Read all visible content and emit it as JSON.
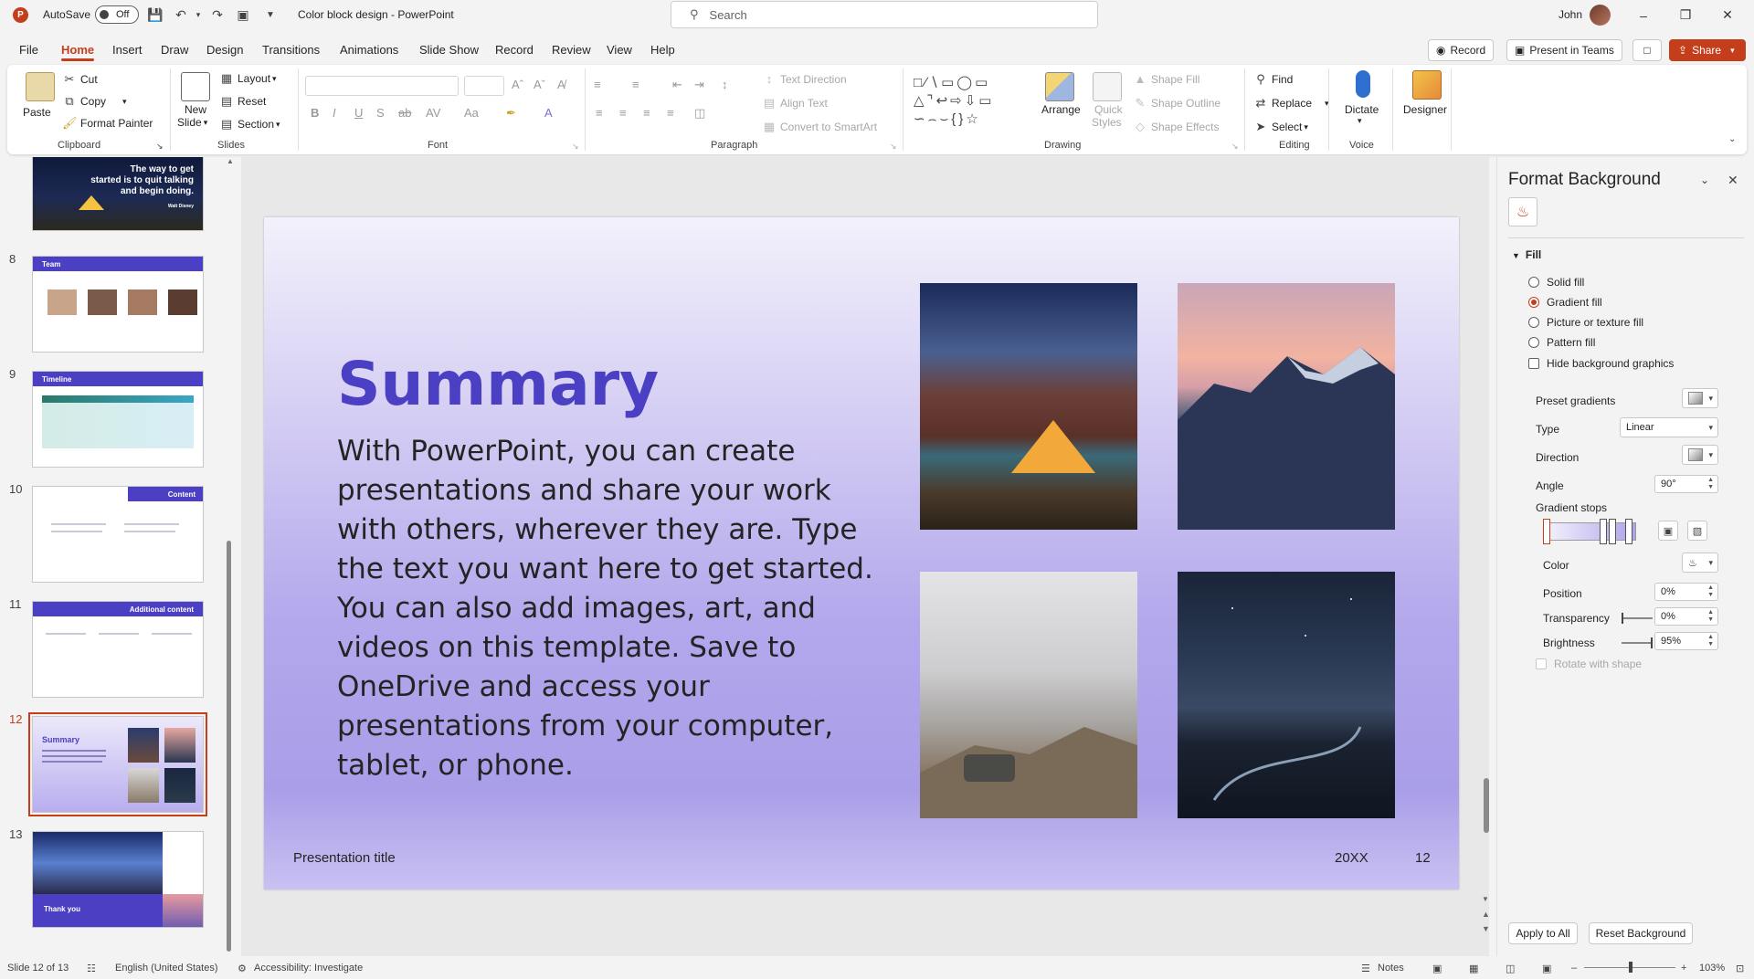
{
  "titlebar": {
    "app_letter": "P",
    "autosave_label": "AutoSave",
    "autosave_state": "Off",
    "doc_title": "Color block design  -  PowerPoint",
    "search_placeholder": "Search",
    "user_name": "John"
  },
  "tabs": [
    "File",
    "Home",
    "Insert",
    "Draw",
    "Design",
    "Transitions",
    "Animations",
    "Slide Show",
    "Record",
    "Review",
    "View",
    "Help"
  ],
  "active_tab": "Home",
  "top_buttons": {
    "record": "Record",
    "present": "Present in Teams",
    "share": "Share"
  },
  "ribbon": {
    "clipboard": {
      "label": "Clipboard",
      "paste": "Paste",
      "cut": "Cut",
      "copy": "Copy",
      "format_painter": "Format Painter"
    },
    "slides": {
      "label": "Slides",
      "new_slide": "New",
      "new_slide2": "Slide",
      "layout": "Layout",
      "reset": "Reset",
      "section": "Section"
    },
    "font": {
      "label": "Font"
    },
    "paragraph": {
      "label": "Paragraph",
      "text_direction": "Text Direction",
      "align_text": "Align Text",
      "convert": "Convert to SmartArt"
    },
    "drawing": {
      "label": "Drawing",
      "arrange": "Arrange",
      "quick": "Quick",
      "styles": "Styles",
      "shape_fill": "Shape Fill",
      "shape_outline": "Shape Outline",
      "shape_effects": "Shape Effects"
    },
    "editing": {
      "label": "Editing",
      "find": "Find",
      "replace": "Replace",
      "select": "Select"
    },
    "voice": {
      "label": "Voice",
      "dictate": "Dictate"
    },
    "designer": {
      "label": "Designer"
    }
  },
  "thumbnails": {
    "slide7_quote_line1": "The way to get",
    "slide7_quote_line2": "started is to quit  talking",
    "slide7_quote_line3": "and begin doing.",
    "slide7_author": "Walt Disney",
    "items": [
      {
        "num": "8",
        "title": "Team"
      },
      {
        "num": "9",
        "title": "Timeline"
      },
      {
        "num": "10",
        "title": "Content"
      },
      {
        "num": "11",
        "title": "Additional content"
      },
      {
        "num": "12",
        "title": "Summary"
      },
      {
        "num": "13",
        "title": "Thank you"
      }
    ]
  },
  "slide": {
    "title": "Summary",
    "body": "With PowerPoint, you can create presentations and share your work with others, wherever they are. Type the text you want here to get started. You can also add images, art, and videos on this template. Save to OneDrive and access your presentations from your computer, tablet, or phone.",
    "footer_title": "Presentation title",
    "footer_date": "20XX",
    "footer_page": "12",
    "accent_color": "#4b3fc4"
  },
  "format_pane": {
    "title": "Format Background",
    "section": "Fill",
    "fill_options": [
      "Solid fill",
      "Gradient fill",
      "Picture or texture fill",
      "Pattern fill"
    ],
    "selected_fill": "Gradient fill",
    "hide_bg": "Hide background graphics",
    "preset_gradients": "Preset gradients",
    "type_label": "Type",
    "type_value": "Linear",
    "direction_label": "Direction",
    "angle_label": "Angle",
    "angle_value": "90°",
    "gradient_stops": "Gradient stops",
    "color_label": "Color",
    "position_label": "Position",
    "position_value": "0%",
    "transparency_label": "Transparency",
    "transparency_value": "0%",
    "brightness_label": "Brightness",
    "brightness_value": "95%",
    "rotate_label": "Rotate with shape",
    "apply_all": "Apply to All",
    "reset_bg": "Reset Background"
  },
  "status": {
    "slide_info": "Slide 12 of 13",
    "language": "English (United States)",
    "accessibility": "Accessibility: Investigate",
    "notes": "Notes",
    "zoom": "103%"
  }
}
